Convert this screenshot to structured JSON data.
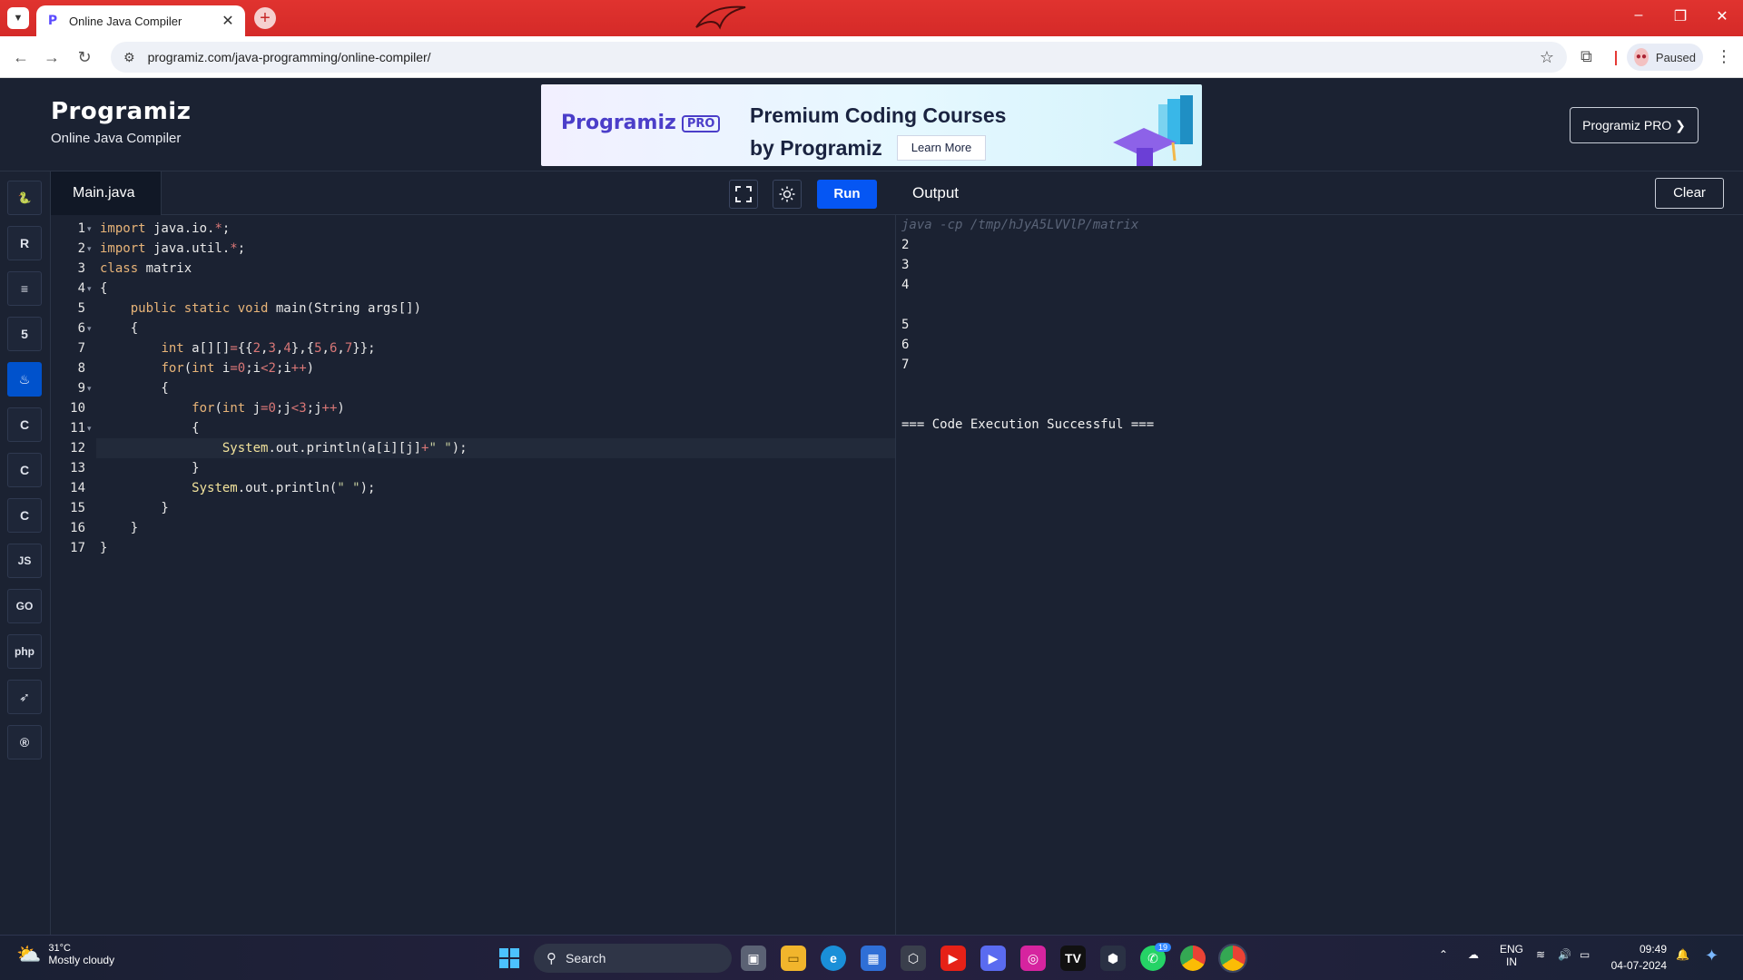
{
  "browser": {
    "tab_title": "Online Java Compiler",
    "tab_favicon": "P",
    "url": "programiz.com/java-programming/online-compiler/",
    "profile_status": "Paused"
  },
  "header": {
    "logo_text": "Programiz",
    "subtitle": "Online Java Compiler",
    "ad": {
      "logo_text": "Programiz",
      "logo_badge": "PRO",
      "title_line1": "Premium Coding Courses",
      "title_line2": "by Programiz",
      "cta": "Learn More"
    },
    "pro_button": "Programiz PRO ❯"
  },
  "languages": [
    {
      "name": "python-icon",
      "glyph": "🐍",
      "active": false
    },
    {
      "name": "r-icon",
      "glyph": "R",
      "active": false
    },
    {
      "name": "sql-database-icon",
      "glyph": "≡",
      "active": false
    },
    {
      "name": "html5-icon",
      "glyph": "5",
      "active": false
    },
    {
      "name": "java-icon",
      "glyph": "♨",
      "active": true
    },
    {
      "name": "c-icon",
      "glyph": "C",
      "active": false
    },
    {
      "name": "cpp-icon",
      "glyph": "C",
      "active": false
    },
    {
      "name": "csharp-icon",
      "glyph": "C",
      "active": false
    },
    {
      "name": "javascript-icon",
      "glyph": "JS",
      "active": false
    },
    {
      "name": "go-icon",
      "glyph": "GO",
      "active": false
    },
    {
      "name": "php-icon",
      "glyph": "php",
      "active": false
    },
    {
      "name": "swift-icon",
      "glyph": "➶",
      "active": false
    },
    {
      "name": "rust-icon",
      "glyph": "®",
      "active": false
    }
  ],
  "editor": {
    "file_tab": "Main.java",
    "run_label": "Run",
    "lines": [
      {
        "n": "1",
        "fold": true
      },
      {
        "n": "2",
        "fold": true
      },
      {
        "n": "3",
        "fold": false
      },
      {
        "n": "4",
        "fold": true
      },
      {
        "n": "5",
        "fold": false
      },
      {
        "n": "6",
        "fold": true
      },
      {
        "n": "7",
        "fold": false
      },
      {
        "n": "8",
        "fold": false
      },
      {
        "n": "9",
        "fold": true
      },
      {
        "n": "10",
        "fold": false
      },
      {
        "n": "11",
        "fold": true
      },
      {
        "n": "12",
        "fold": false
      },
      {
        "n": "13",
        "fold": false
      },
      {
        "n": "14",
        "fold": false
      },
      {
        "n": "15",
        "fold": false
      },
      {
        "n": "16",
        "fold": false
      },
      {
        "n": "17",
        "fold": false
      }
    ],
    "code": [
      [
        [
          "kw",
          "import"
        ],
        [
          "t",
          " java.io."
        ],
        [
          "op",
          "*"
        ],
        [
          "t",
          ";"
        ]
      ],
      [
        [
          "kw",
          "import"
        ],
        [
          "t",
          " java.util."
        ],
        [
          "op",
          "*"
        ],
        [
          "t",
          ";"
        ]
      ],
      [
        [
          "kw",
          "class"
        ],
        [
          "t",
          " matrix"
        ]
      ],
      [
        [
          "t",
          "{"
        ]
      ],
      [
        [
          "t",
          "    "
        ],
        [
          "kw",
          "public static void"
        ],
        [
          "t",
          " main(String args[])"
        ]
      ],
      [
        [
          "t",
          "    {"
        ]
      ],
      [
        [
          "t",
          "        "
        ],
        [
          "kw",
          "int"
        ],
        [
          "t",
          " a[][]"
        ],
        [
          "op",
          "="
        ],
        [
          "t",
          "{{"
        ],
        [
          "num",
          "2"
        ],
        [
          "t",
          ","
        ],
        [
          "num",
          "3"
        ],
        [
          "t",
          ","
        ],
        [
          "num",
          "4"
        ],
        [
          "t",
          "},{"
        ],
        [
          "num",
          "5"
        ],
        [
          "t",
          ","
        ],
        [
          "num",
          "6"
        ],
        [
          "t",
          ","
        ],
        [
          "num",
          "7"
        ],
        [
          "t",
          "}};"
        ]
      ],
      [
        [
          "t",
          "        "
        ],
        [
          "kw",
          "for"
        ],
        [
          "t",
          "("
        ],
        [
          "kw",
          "int"
        ],
        [
          "t",
          " i"
        ],
        [
          "op",
          "="
        ],
        [
          "num",
          "0"
        ],
        [
          "t",
          ";i"
        ],
        [
          "op",
          "<"
        ],
        [
          "num",
          "2"
        ],
        [
          "t",
          ";i"
        ],
        [
          "op",
          "++"
        ],
        [
          "t",
          ")"
        ]
      ],
      [
        [
          "t",
          "        {"
        ]
      ],
      [
        [
          "t",
          "            "
        ],
        [
          "kw",
          "for"
        ],
        [
          "t",
          "("
        ],
        [
          "kw",
          "int"
        ],
        [
          "t",
          " j"
        ],
        [
          "op",
          "="
        ],
        [
          "num",
          "0"
        ],
        [
          "t",
          ";j"
        ],
        [
          "op",
          "<"
        ],
        [
          "num",
          "3"
        ],
        [
          "t",
          ";j"
        ],
        [
          "op",
          "++"
        ],
        [
          "t",
          ")"
        ]
      ],
      [
        [
          "t",
          "            {"
        ]
      ],
      [
        [
          "t",
          "                "
        ],
        [
          "fn",
          "System"
        ],
        [
          "t",
          ".out.println(a[i][j]"
        ],
        [
          "op",
          "+"
        ],
        [
          "str",
          "\" \""
        ],
        [
          "t",
          ");"
        ]
      ],
      [
        [
          "t",
          "            }"
        ]
      ],
      [
        [
          "t",
          "            "
        ],
        [
          "fn",
          "System"
        ],
        [
          "t",
          ".out.println("
        ],
        [
          "str",
          "\" \""
        ],
        [
          "t",
          ");"
        ]
      ],
      [
        [
          "t",
          "        }"
        ]
      ],
      [
        [
          "t",
          "    }"
        ]
      ],
      [
        [
          "t",
          "}"
        ]
      ]
    ],
    "highlighted_line": 12
  },
  "output": {
    "title": "Output",
    "clear_label": "Clear",
    "command": "java -cp /tmp/hJyA5LVVlP/matrix",
    "lines": [
      "2",
      "3",
      "4",
      "",
      "5",
      "6",
      "7",
      "",
      "",
      "=== Code Execution Successful ==="
    ]
  },
  "taskbar": {
    "temperature": "31°C",
    "weather": "Mostly cloudy",
    "search_placeholder": "Search",
    "whatsapp_badge": "19",
    "lang_line1": "ENG",
    "lang_line2": "IN",
    "time": "09:49",
    "date": "04-07-2024"
  },
  "colors": {
    "run_button": "#0556f3",
    "active_language": "#0052cc",
    "background": "#1b2232"
  }
}
